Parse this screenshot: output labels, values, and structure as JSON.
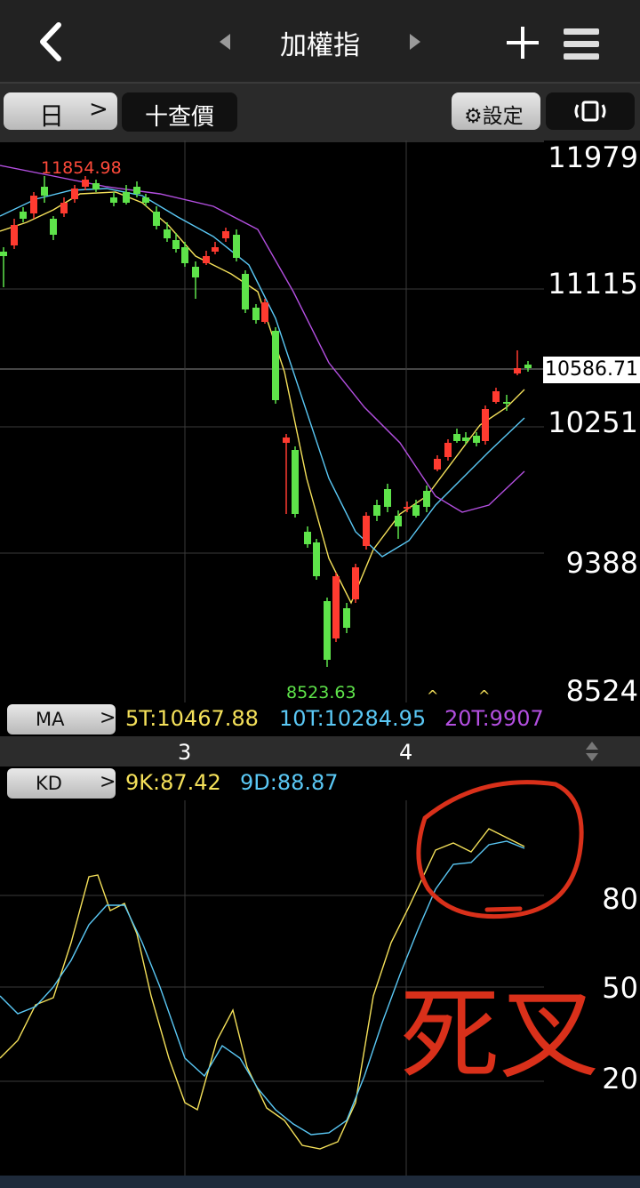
{
  "header": {
    "title": "加權指"
  },
  "toolbar": {
    "period_label": "日",
    "quote_label": "十查價",
    "setting_label": "設定"
  },
  "price_axis": {
    "labels": [
      "11979",
      "11115",
      "10251",
      "9388",
      "8524"
    ],
    "current_price": "10586.71"
  },
  "annotations": {
    "high": "11854.98",
    "low": "8523.63"
  },
  "ma_legend": {
    "button": "MA",
    "ma5": "5T:10467.88",
    "ma10": "10T:10284.95",
    "ma20": "20T:9907"
  },
  "date_labels": [
    "3",
    "4"
  ],
  "kd_legend": {
    "button": "KD",
    "k": "9K:87.42",
    "d": "9D:88.87"
  },
  "kd_axis": {
    "labels": [
      "80",
      "50",
      "20"
    ]
  },
  "handwriting": {
    "text": "死叉"
  },
  "colors": {
    "up": "#ff3b30",
    "down": "#5ee34a",
    "ma5": "#f5e15a",
    "ma10": "#5ac8f5",
    "ma20": "#b34fe0",
    "marker": "#d9301a"
  }
}
